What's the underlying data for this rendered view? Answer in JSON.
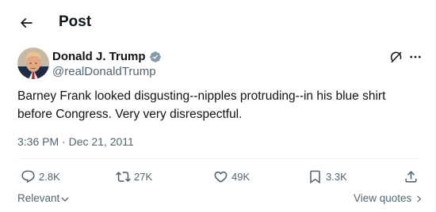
{
  "header": {
    "title": "Post"
  },
  "author": {
    "name": "Donald J. Trump",
    "handle": "@realDonaldTrump",
    "verified": true
  },
  "tweet": {
    "text_line1": "Barney Frank looked disgusting--nipples protruding--in his blue shirt",
    "text_line2": "before Congress. Very very disrespectful.",
    "timestamp": "3:36 PM · Dec 21, 2011"
  },
  "actions": {
    "replies": "2.8K",
    "reposts": "27K",
    "likes": "49K",
    "bookmarks": "3.3K"
  },
  "footer": {
    "sort_label": "Relevant",
    "view_quotes": "View quotes"
  },
  "icons": {
    "back": "back-arrow-icon",
    "verified": "verified-badge-icon",
    "grok": "grok-icon",
    "more": "more-icon",
    "reply": "reply-icon",
    "repost": "repost-icon",
    "like": "like-icon",
    "bookmark": "bookmark-icon",
    "share": "share-icon"
  },
  "colors": {
    "text_primary": "#0f1419",
    "text_secondary": "#536471",
    "verified_badge": "#829aab",
    "divider": "#eff3f4"
  }
}
